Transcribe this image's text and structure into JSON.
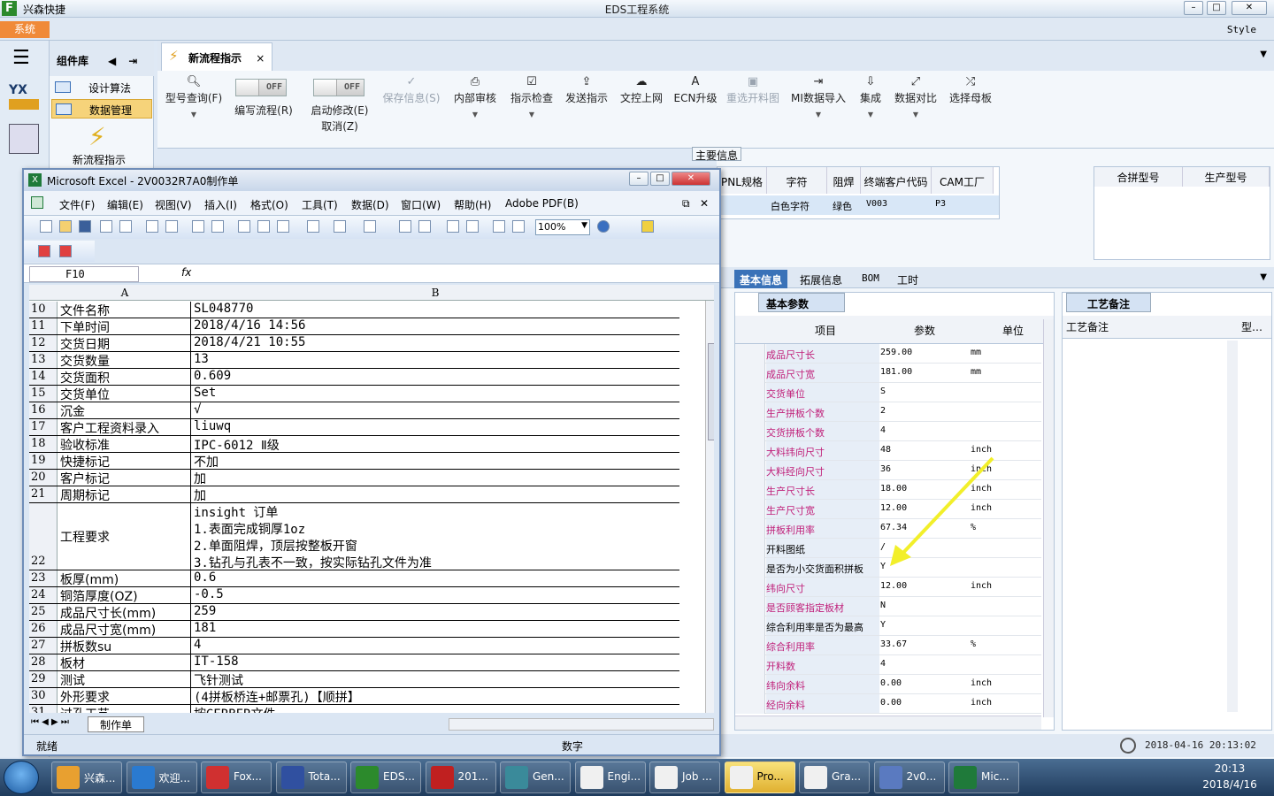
{
  "eds": {
    "app_name": "兴森快捷",
    "window_title": "EDS工程系统",
    "system_btn": "系统",
    "style_label": "Style",
    "component_lib": "组件库",
    "comp_items": [
      "设计算法",
      "数据管理"
    ],
    "new_flow_label": "新流程指示",
    "tab_label": "新流程指示",
    "ribbon": {
      "query": "型号查询(F)",
      "write_flow": "编写流程(R)",
      "start_modify": "启动修改(E)",
      "cancel": "取消(Z)",
      "save_info": "保存信息(S)",
      "internal_review": "内部审核",
      "check": "指示检查",
      "send": "发送指示",
      "upload": "文控上网",
      "ecn": "ECN升级",
      "reselect": "重选开料图",
      "mi_import": "MI数据导入",
      "integrate": "集成",
      "compare": "数据对比",
      "mother_board": "选择母板",
      "toggle_off": "OFF"
    },
    "main_info": "主要信息",
    "header_cols": [
      "PNL规格",
      "字符",
      "阻焊",
      "终端客户代码",
      "CAM工厂"
    ],
    "header_vals": [
      "白色字符",
      "绿色",
      "V003",
      "P3"
    ],
    "right_cols": [
      "合拼型号",
      "生产型号"
    ],
    "bottom_tabs": [
      "基本信息",
      "拓展信息",
      "BOM",
      "工时"
    ],
    "params_tab": "基本参数",
    "param_headers": [
      "项目",
      "参数",
      "单位"
    ],
    "params": [
      {
        "name": "成品尺寸长",
        "value": "259.00",
        "unit": "mm",
        "pink": true
      },
      {
        "name": "成品尺寸宽",
        "value": "181.00",
        "unit": "mm",
        "pink": true
      },
      {
        "name": "交货单位",
        "value": "S",
        "unit": "",
        "pink": true
      },
      {
        "name": "生产拼板个数",
        "value": "2",
        "unit": "",
        "pink": true
      },
      {
        "name": "交货拼板个数",
        "value": "4",
        "unit": "",
        "pink": true
      },
      {
        "name": "大料纬向尺寸",
        "value": "48",
        "unit": "inch",
        "pink": true
      },
      {
        "name": "大料经向尺寸",
        "value": "36",
        "unit": "inch",
        "pink": true
      },
      {
        "name": "生产尺寸长",
        "value": "18.00",
        "unit": "inch",
        "pink": true
      },
      {
        "name": "生产尺寸宽",
        "value": "12.00",
        "unit": "inch",
        "pink": true
      },
      {
        "name": "拼板利用率",
        "value": "67.34",
        "unit": "%",
        "pink": true
      },
      {
        "name": "开料图纸",
        "value": "/",
        "unit": "",
        "pink": false
      },
      {
        "name": "是否为小交货面积拼板",
        "value": "Y",
        "unit": "",
        "pink": false
      },
      {
        "name": "纬向尺寸",
        "value": "12.00",
        "unit": "inch",
        "pink": true
      },
      {
        "name": "是否顾客指定板材",
        "value": "N",
        "unit": "",
        "pink": true
      },
      {
        "name": "综合利用率是否为最高",
        "value": "Y",
        "unit": "",
        "pink": false
      },
      {
        "name": "综合利用率",
        "value": "33.67",
        "unit": "%",
        "pink": true
      },
      {
        "name": "开料数",
        "value": "4",
        "unit": "",
        "pink": true
      },
      {
        "name": "纬向余料",
        "value": "0.00",
        "unit": "inch",
        "pink": true
      },
      {
        "name": "经向余料",
        "value": "0.00",
        "unit": "inch",
        "pink": true
      }
    ],
    "process_note_tab": "工艺备注",
    "process_note_hdr": "工艺备注",
    "process_note_col2": "型…",
    "datetime": "2018-04-16 20:13:02"
  },
  "excel": {
    "title": "Microsoft Excel - 2V0032R7A0制作单",
    "menus": [
      "文件(F)",
      "编辑(E)",
      "视图(V)",
      "插入(I)",
      "格式(O)",
      "工具(T)",
      "数据(D)",
      "窗口(W)",
      "帮助(H)",
      "Adobe PDF(B)"
    ],
    "zoom": "100%",
    "cell_ref": "F10",
    "fx": "fx",
    "col_a": "A",
    "col_b": "B",
    "rows": [
      {
        "n": "10",
        "a": "文件名称",
        "b": "SL048770"
      },
      {
        "n": "11",
        "a": "下单时间",
        "b": "2018/4/16 14:56"
      },
      {
        "n": "12",
        "a": "交货日期",
        "b": "2018/4/21 10:55"
      },
      {
        "n": "13",
        "a": "交货数量",
        "b": "13"
      },
      {
        "n": "14",
        "a": "交货面积",
        "b": "0.609"
      },
      {
        "n": "15",
        "a": "交货单位",
        "b": "Set"
      },
      {
        "n": "16",
        "a": "沉金",
        "b": "√"
      },
      {
        "n": "17",
        "a": "客户工程资料录入",
        "b": "liuwq"
      },
      {
        "n": "18",
        "a": "验收标准",
        "b": "IPC-6012 Ⅱ级"
      },
      {
        "n": "19",
        "a": "快捷标记",
        "b": "不加"
      },
      {
        "n": "20",
        "a": "客户标记",
        "b": "加"
      },
      {
        "n": "21",
        "a": "周期标记",
        "b": "加"
      }
    ],
    "row22": {
      "n": "22",
      "a": "工程要求",
      "lines": [
        "insight 订单",
        "1.表面完成铜厚1oz",
        "2.单面阻焊，顶层按整板开窗",
        "3.钻孔与孔表不一致，按实际钻孔文件为准"
      ]
    },
    "rows2": [
      {
        "n": "23",
        "a": "板厚(mm)",
        "b": "0.6"
      },
      {
        "n": "24",
        "a": "铜箔厚度(OZ)",
        "b": "-0.5"
      },
      {
        "n": "25",
        "a": "成品尺寸长(mm)",
        "b": "259"
      },
      {
        "n": "26",
        "a": "成品尺寸宽(mm)",
        "b": "181"
      },
      {
        "n": "27",
        "a": "拼板数su",
        "b": "4"
      },
      {
        "n": "28",
        "a": "板材",
        "b": "IT-158"
      },
      {
        "n": "29",
        "a": "测试",
        "b": "飞针测试"
      },
      {
        "n": "30",
        "a": "外形要求",
        "b": "(4拼板桥连+邮票孔)【顺拼】"
      },
      {
        "n": "31",
        "a": "过孔工艺",
        "b": "按GERBER文件"
      }
    ],
    "sheet_tab": "制作单",
    "status_left": "就绪",
    "status_num": "数字"
  },
  "taskbar": {
    "items": [
      "兴森...",
      "欢迎...",
      "Fox...",
      "Tota...",
      "EDS...",
      "201...",
      "Gen...",
      "Engi...",
      "Job ...",
      "Pro...",
      "Gra...",
      "2v0...",
      "Mic..."
    ],
    "time": "20:13",
    "date": "2018/4/16"
  }
}
